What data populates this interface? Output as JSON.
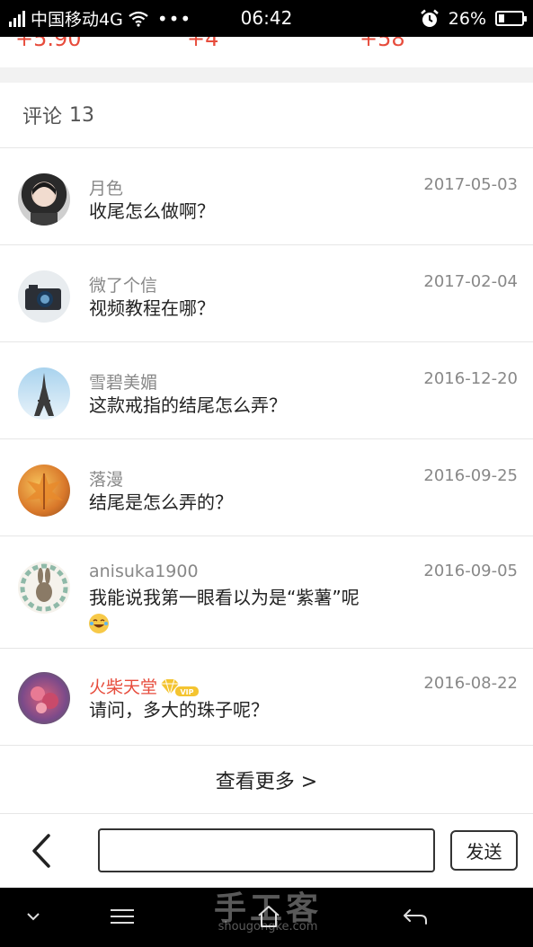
{
  "status_bar": {
    "carrier": "中国移动4G",
    "more": "•••",
    "time": "06:42",
    "battery": "26%",
    "battery_level": 0.26
  },
  "stats": {
    "values": [
      "+5.90",
      "+4",
      "+58"
    ],
    "color": "#e74c3c"
  },
  "comments_header": {
    "label": "评论",
    "count": "13"
  },
  "comments": [
    {
      "user": "月色",
      "date": "2017-05-03",
      "text": "收尾怎么做啊？",
      "avatar": "girl-portrait"
    },
    {
      "user": "微了个信",
      "date": "2017-02-04",
      "text": "视频教程在哪？",
      "avatar": "camera"
    },
    {
      "user": "雪碧美媚",
      "date": "2016-12-20",
      "text": "这款戒指的结尾怎么弄？",
      "avatar": "eiffel-tower"
    },
    {
      "user": "落漫",
      "date": "2016-09-25",
      "text": "结尾是怎么弄的？",
      "avatar": "autumn-leaf"
    },
    {
      "user": "anisuka1900",
      "date": "2016-09-05",
      "text": "我能说我第一眼看以为是“紫薯”呢",
      "avatar": "rabbit-wreath",
      "emoji": "laughing-tears-emoji"
    },
    {
      "user": "火柴天堂",
      "date": "2016-08-22",
      "text": "请问，多大的珠子呢？",
      "avatar": "flowers",
      "vip": true,
      "vip_label": "VIP"
    }
  ],
  "view_more": "查看更多 >",
  "input_bar": {
    "placeholder": "",
    "send_label": "发送"
  },
  "watermark": {
    "main": "手工客",
    "sub": "shougongke.com"
  },
  "icons": {
    "back": "chevron-left-icon",
    "nav_down": "chevron-down-icon",
    "nav_menu": "menu-icon",
    "nav_home": "home-icon",
    "nav_back": "back-arrow-icon"
  }
}
